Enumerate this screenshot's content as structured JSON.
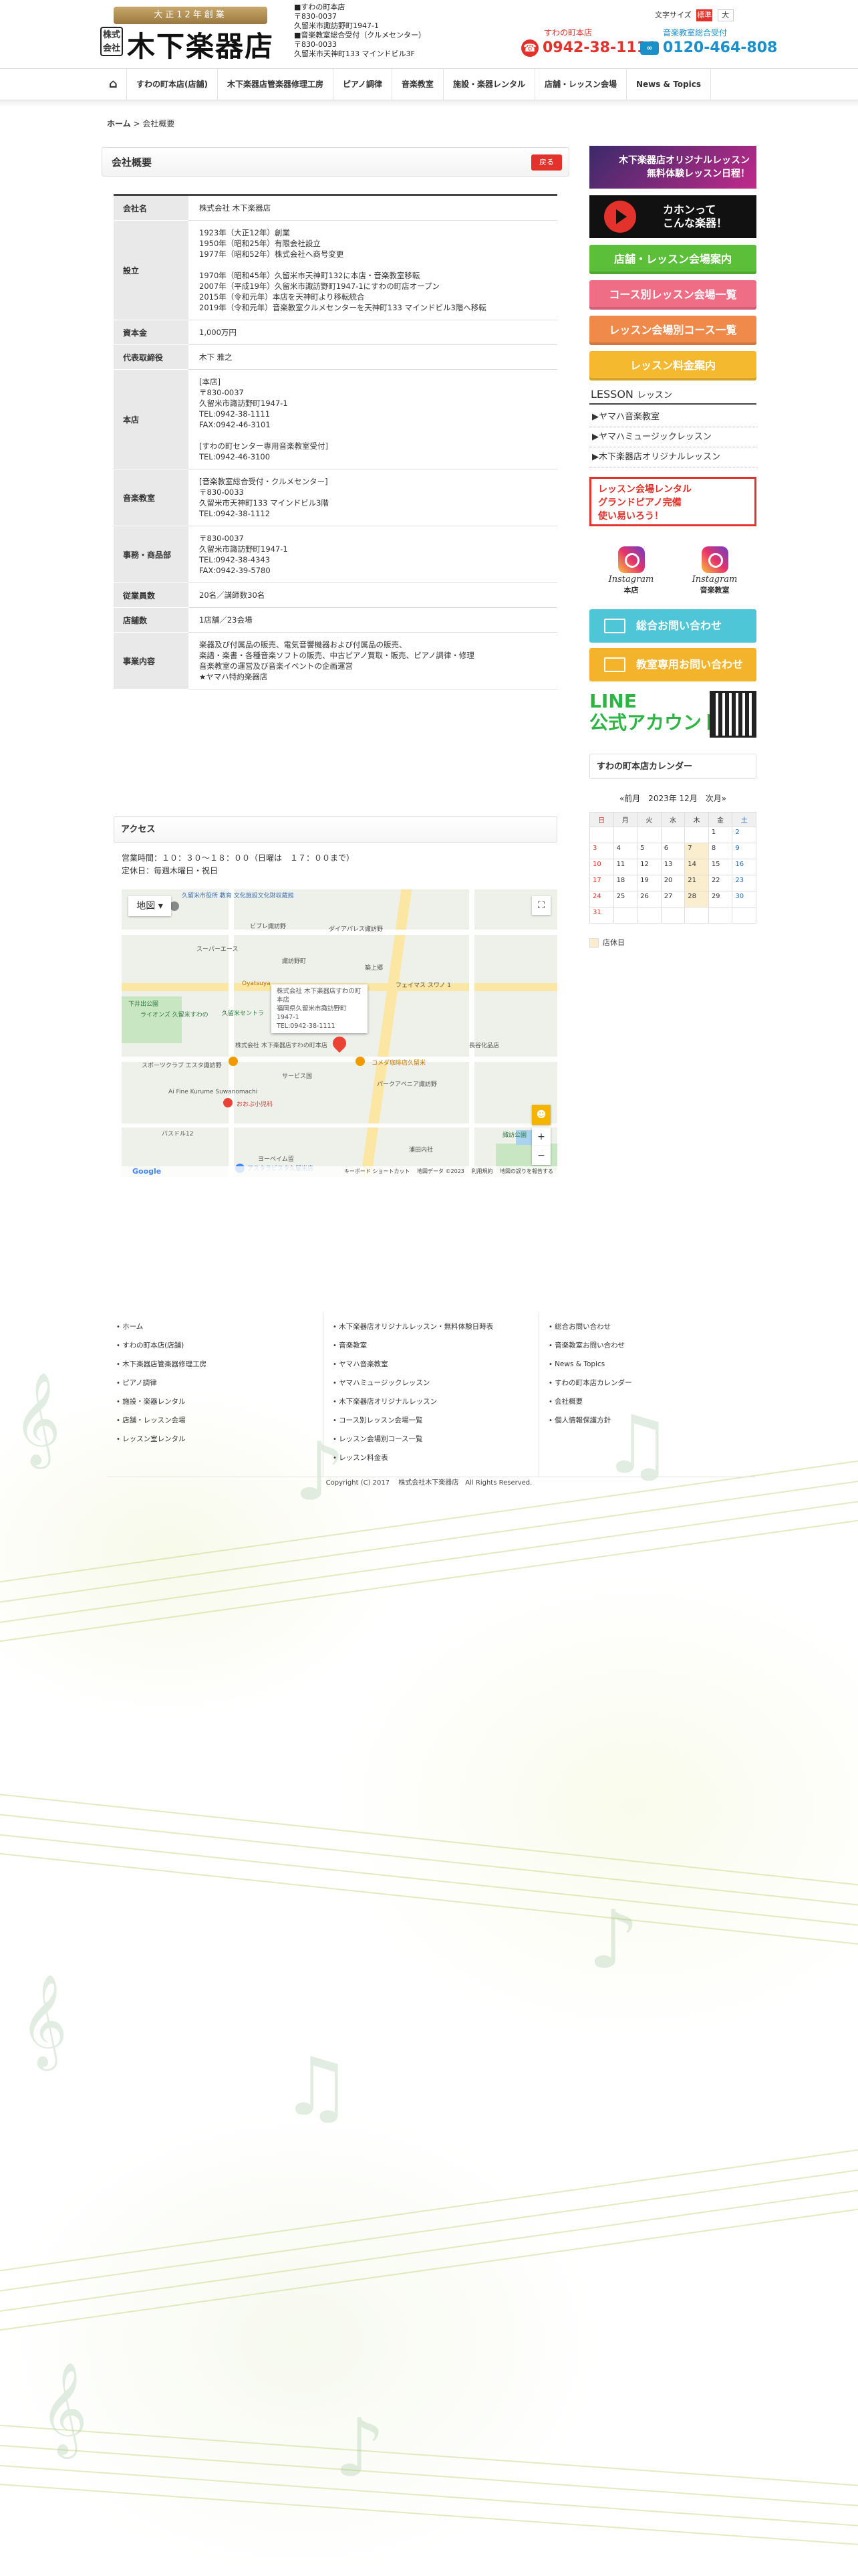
{
  "header": {
    "logo_ribbon": "大正12年創業",
    "logo_kabu": "株式会社",
    "logo_name": "木下楽器店",
    "info_lines": [
      "■すわの町本店",
      "〒830-0037",
      "久留米市諏訪野町1947-1",
      "■音楽教室総合受付（クルメセンター）",
      "〒830-0033",
      "久留米市天神町133 マインドビル3F"
    ],
    "font_size_label": "文字サイズ",
    "font_size_std": "標準",
    "font_size_large": "大",
    "tel1_label": "すわの町本店",
    "tel1_number": "0942-38-1111",
    "tel2_label": "音楽教室総合受付",
    "tel2_number": "0120-464-808"
  },
  "nav": {
    "items": [
      "すわの町本店(店舗)",
      "木下楽器店管楽器修理工房",
      "ピアノ調律",
      "音楽教室",
      "施設・楽器レンタル",
      "店舗・レッスン会場",
      "News & Topics"
    ]
  },
  "breadcrumb": {
    "home": "ホーム",
    "sep": " > ",
    "current": "会社概要"
  },
  "main": {
    "title": "会社概要",
    "back_label": "戻る",
    "rows": [
      {
        "th": "会社名",
        "td": "株式会社 木下楽器店"
      },
      {
        "th": "設立",
        "td": "1923年（大正12年）創業\n1950年（昭和25年）有限会社設立\n1977年（昭和52年）株式会社へ商号変更\n\n1970年（昭和45年）久留米市天神町132に本店・音楽教室移転\n2007年（平成19年）久留米市諏訪野町1947-1にすわの町店オープン\n2015年（令和元年）本店を天神町より移転統合\n2019年（令和元年）音楽教室クルメセンターを天神町133 マインドビル3階へ移転"
      },
      {
        "th": "資本金",
        "td": "1,000万円"
      },
      {
        "th": "代表取締役",
        "td": "木下 雅之"
      },
      {
        "th": "本店",
        "td": "[本店]\n〒830-0037\n久留米市諏訪野町1947-1\nTEL:0942-38-1111\nFAX:0942-46-3101\n\n[すわの町センター専用音楽教室受付]\nTEL:0942-46-3100"
      },
      {
        "th": "音楽教室",
        "td": "[音楽教室総合受付・クルメセンター]\n〒830-0033\n久留米市天神町133 マインドビル3階\nTEL:0942-38-1112"
      },
      {
        "th": "事務・商品部",
        "td": "〒830-0037\n久留米市諏訪野町1947-1\nTEL:0942-38-4343\nFAX:0942-39-5780"
      },
      {
        "th": "従業員数",
        "td": "20名／講師数30名"
      },
      {
        "th": "店舗数",
        "td": "1店舗／23会場"
      },
      {
        "th": "事業内容",
        "td": "楽器及び付属品の販売、電気音響機器および付属品の販売、\n楽譜・楽書・各種音楽ソフトの販売、中古ピアノ買取・販売、ピアノ調律・修理\n音楽教室の運営及び音楽イベントの企画運営\n★ヤマハ特約楽器店"
      }
    ],
    "access_title": "アクセス",
    "hours": "営業時間：１０：３０〜１８：００（日曜は　１７：００まで）\n定休日：毎週木曜日・祝日"
  },
  "map": {
    "type_button": "地図",
    "popup": "株式会社 木下楽器店すわの町本店\n福岡県久留米市諏訪野町1947-1\nTEL:0942-38-1111",
    "labels": [
      "久留米市役所 教育\n文化施設文化財収蔵館",
      "ビブレ諏訪野",
      "ダイアパレス諏訪野",
      "スーパーエース",
      "諏訪野町",
      "Oyatsuya",
      "築上郷",
      "下井出公園",
      "ライオンズ\n久留米すわの",
      "久留米セントラ",
      "株式会社 木下楽器店すわの町本店",
      "スポーツクラブ\nエスタ諏訪野",
      "コメダ珈琲店久留米",
      "パークアベニア諏訪野",
      "Ai Fine Kurume\nSuwanomachi",
      "おおぶ小児科",
      "バスドル12",
      "アスタラビスタ久留米店",
      "ヨーベイム留",
      "フェイマス スワノ 1",
      "長谷化品店",
      "浦田内社",
      "サービス国",
      "諏訪公園"
    ],
    "footer": [
      "キーボード ショートカット",
      "地図データ ©2023",
      "利用規約",
      "地図の誤りを報告する"
    ],
    "google": "Google"
  },
  "sidebar": {
    "banner1": "木下楽器店オリジナルレッスン\n無料体験レッスン日程！",
    "banner2": "カホンって\nこんな楽器！",
    "btn_venue": "店舗・レッスン会場案内",
    "btn_course_venue": "コース別レッスン会場一覧",
    "btn_venue_course": "レッスン会場別コース一覧",
    "btn_fee": "レッスン料金案内",
    "lesson_head": "LESSON",
    "lesson_head_jp": "レッスン",
    "lessons": [
      "ヤマハ音楽教室",
      "ヤマハミュージックレッスン",
      "木下楽器店オリジナルレッスン"
    ],
    "rental": "レッスン会場レンタル\nグランドピアノ完備\n使い易いろう！",
    "instagram": [
      {
        "cap": "Instagram",
        "sub": "本店"
      },
      {
        "cap": "Instagram",
        "sub": "音楽教室"
      }
    ],
    "contact1": "総合お問い合わせ",
    "contact2": "教室専用お問い合わせ",
    "line": "LINE\n公式アカウント",
    "calendar_title": "すわの町本店カレンダー",
    "calendar_nav": "«前月　2023年 12月　次月»",
    "weekdays": [
      "日",
      "月",
      "火",
      "水",
      "木",
      "金",
      "土"
    ],
    "weeks": [
      [
        "",
        "",
        "",
        "",
        "",
        "1",
        "2"
      ],
      [
        "3",
        "4",
        "5",
        "6",
        "7",
        "8",
        "9"
      ],
      [
        "10",
        "11",
        "12",
        "13",
        "14",
        "15",
        "16"
      ],
      [
        "17",
        "18",
        "19",
        "20",
        "21",
        "22",
        "23"
      ],
      [
        "24",
        "25",
        "26",
        "27",
        "28",
        "29",
        "30"
      ],
      [
        "31",
        "",
        "",
        "",
        "",
        "",
        ""
      ]
    ],
    "legend": "店休日"
  },
  "footer": {
    "col1": [
      "ホーム",
      "すわの町本店(店舗)",
      "木下楽器店管楽器修理工房",
      "ピアノ調律",
      "施設・楽器レンタル",
      "店舗・レッスン会場",
      "レッスン室レンタル"
    ],
    "col2": [
      "木下楽器店オリジナルレッスン・無料体験日時表",
      "音楽教室",
      "ヤマハ音楽教室",
      "ヤマハミュージックレッスン",
      "木下楽器店オリジナルレッスン",
      "コース別レッスン会場一覧",
      "レッスン会場別コース一覧",
      "レッスン料金表"
    ],
    "col3": [
      "総合お問い合わせ",
      "音楽教室お問い合わせ",
      "News & Topics",
      "すわの町本店カレンダー",
      "会社概要",
      "個人情報保護方針"
    ],
    "copyright": "Copyright (C) 2017 　株式会社木下楽器店　All Rights Reserved."
  },
  "colors": {
    "accent_red": "#e2322b",
    "accent_blue": "#1a8fc9",
    "line_green": "#2db543"
  }
}
